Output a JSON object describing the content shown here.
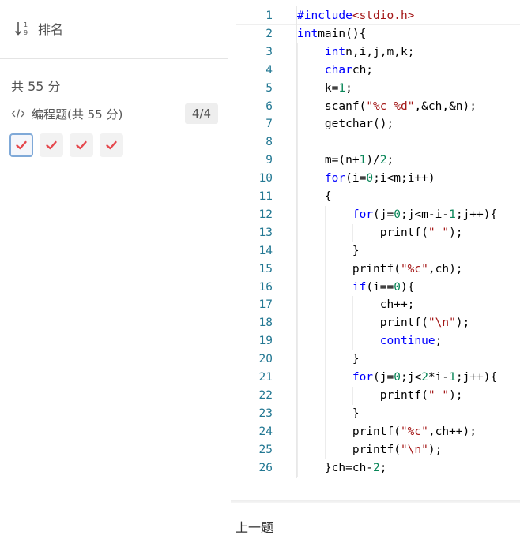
{
  "sort": {
    "label": "排名"
  },
  "total_score": "共 55 分",
  "section": {
    "title": "编程题(共 55 分)",
    "progress": "4/4"
  },
  "answers": [
    {
      "state": "correct"
    },
    {
      "state": "correct"
    },
    {
      "state": "correct"
    },
    {
      "state": "correct"
    }
  ],
  "colors": {
    "check": "#e5484d",
    "line_number": "#237893",
    "keyword": "#0000ff",
    "string": "#a31515",
    "number": "#098658"
  },
  "code": {
    "lines": [
      [
        [
          "kw",
          "#include"
        ],
        [
          "str",
          "<stdio.h>"
        ]
      ],
      [
        [
          "kw",
          "int"
        ],
        [
          "",
          "main(){"
        ]
      ],
      [
        [
          "",
          "    "
        ],
        [
          "kw",
          "int"
        ],
        [
          "",
          "n,i,j,m,k;"
        ]
      ],
      [
        [
          "",
          "    "
        ],
        [
          "kw",
          "char"
        ],
        [
          "",
          "ch;"
        ]
      ],
      [
        [
          "",
          "    k="
        ],
        [
          "num",
          "1"
        ],
        [
          "",
          ";"
        ]
      ],
      [
        [
          "",
          "    scanf("
        ],
        [
          "str",
          "\"%c %d\""
        ],
        [
          "",
          ",&ch,&n);"
        ]
      ],
      [
        [
          "",
          "    getchar();"
        ]
      ],
      [
        [
          "",
          ""
        ]
      ],
      [
        [
          "",
          "    m=(n+"
        ],
        [
          "num",
          "1"
        ],
        [
          "",
          ")/"
        ],
        [
          "num",
          "2"
        ],
        [
          "",
          ";"
        ]
      ],
      [
        [
          "",
          "    "
        ],
        [
          "kw",
          "for"
        ],
        [
          "",
          "(i="
        ],
        [
          "num",
          "0"
        ],
        [
          "",
          ";i<m;i++)"
        ]
      ],
      [
        [
          "",
          "    {"
        ]
      ],
      [
        [
          "",
          "        "
        ],
        [
          "kw",
          "for"
        ],
        [
          "",
          "(j="
        ],
        [
          "num",
          "0"
        ],
        [
          "",
          ";j<m-i-"
        ],
        [
          "num",
          "1"
        ],
        [
          "",
          ";j++){"
        ]
      ],
      [
        [
          "",
          "            printf("
        ],
        [
          "str",
          "\" \""
        ],
        [
          "",
          ");"
        ]
      ],
      [
        [
          "",
          "        }"
        ]
      ],
      [
        [
          "",
          "        printf("
        ],
        [
          "str",
          "\"%c\""
        ],
        [
          "",
          ",ch);"
        ]
      ],
      [
        [
          "",
          "        "
        ],
        [
          "kw",
          "if"
        ],
        [
          "",
          "(i=="
        ],
        [
          "num",
          "0"
        ],
        [
          "",
          "){"
        ]
      ],
      [
        [
          "",
          "            ch++;"
        ]
      ],
      [
        [
          "",
          "            printf("
        ],
        [
          "str",
          "\"\\n\""
        ],
        [
          "",
          ");"
        ]
      ],
      [
        [
          "",
          "            "
        ],
        [
          "kw",
          "continue"
        ],
        [
          "",
          ";"
        ]
      ],
      [
        [
          "",
          "        }"
        ]
      ],
      [
        [
          "",
          "        "
        ],
        [
          "kw",
          "for"
        ],
        [
          "",
          "(j="
        ],
        [
          "num",
          "0"
        ],
        [
          "",
          ";j<"
        ],
        [
          "num",
          "2"
        ],
        [
          "",
          "*i-"
        ],
        [
          "num",
          "1"
        ],
        [
          "",
          ";j++){"
        ]
      ],
      [
        [
          "",
          "            printf("
        ],
        [
          "str",
          "\" \""
        ],
        [
          "",
          ");"
        ]
      ],
      [
        [
          "",
          "        }"
        ]
      ],
      [
        [
          "",
          "        printf("
        ],
        [
          "str",
          "\"%c\""
        ],
        [
          "",
          ",ch++);"
        ]
      ],
      [
        [
          "",
          "        printf("
        ],
        [
          "str",
          "\"\\n\""
        ],
        [
          "",
          ");"
        ]
      ],
      [
        [
          "",
          "    }ch=ch-"
        ],
        [
          "num",
          "2"
        ],
        [
          "",
          ";"
        ]
      ]
    ]
  },
  "footer": {
    "prev_label": "上一题"
  }
}
